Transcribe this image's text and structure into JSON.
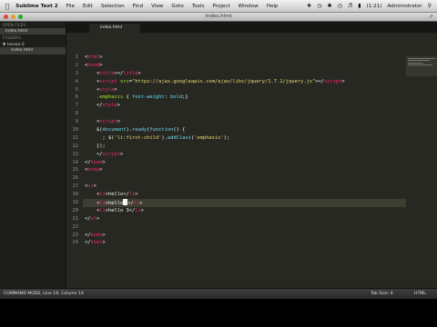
{
  "menubar": {
    "app": "Sublime Text 2",
    "items": [
      "File",
      "Edit",
      "Selection",
      "Find",
      "View",
      "Goto",
      "Tools",
      "Project",
      "Window",
      "Help"
    ],
    "battery": "(1:21)",
    "user": "Administrator"
  },
  "window": {
    "title": "index.html"
  },
  "sidebar": {
    "open_files_header": "OPEN FILES",
    "open_files": [
      "index.html"
    ],
    "folders_header": "FOLDERS",
    "folder": "lesson-2",
    "files": [
      "index.html"
    ]
  },
  "editor": {
    "tab_label": "index.html",
    "current_line": 19,
    "lines": [
      [
        [
          "c-b",
          "<"
        ],
        [
          "c-t",
          "html"
        ],
        [
          "c-b",
          ">"
        ]
      ],
      [
        [
          "c-b",
          "<"
        ],
        [
          "c-t",
          "head"
        ],
        [
          "c-b",
          ">"
        ]
      ],
      [
        [
          "c-b",
          "    <"
        ],
        [
          "c-t",
          "title"
        ],
        [
          "c-b",
          "></"
        ],
        [
          "c-t",
          "title"
        ],
        [
          "c-b",
          ">"
        ]
      ],
      [
        [
          "c-b",
          "    <"
        ],
        [
          "c-t",
          "script"
        ],
        [
          "c-b",
          " "
        ],
        [
          "c-a",
          "src"
        ],
        [
          "c-b",
          "="
        ],
        [
          "c-s",
          "\"https://ajax.googleapis.com/ajax/libs/jquery/1.7.1/jquery.js\""
        ],
        [
          "c-b",
          "></"
        ],
        [
          "c-t",
          "script"
        ],
        [
          "c-b",
          ">"
        ]
      ],
      [
        [
          "c-b",
          "    <"
        ],
        [
          "c-t",
          "style"
        ],
        [
          "c-b",
          ">"
        ]
      ],
      [
        [
          "c-b",
          "    "
        ],
        [
          "c-a",
          ".emphasis"
        ],
        [
          "c-b",
          " { "
        ],
        [
          "c-f",
          "font-weight"
        ],
        [
          "c-b",
          ": "
        ],
        [
          "c-f",
          "bold"
        ],
        [
          "c-b",
          ";}"
        ]
      ],
      [
        [
          "c-b",
          "    </"
        ],
        [
          "c-t",
          "style"
        ],
        [
          "c-b",
          ">"
        ]
      ],
      [],
      [
        [
          "c-b",
          "    <"
        ],
        [
          "c-t",
          "script"
        ],
        [
          "c-b",
          ">"
        ]
      ],
      [
        [
          "c-b",
          "    $("
        ],
        [
          "c-f",
          "document"
        ],
        [
          "c-b",
          ")."
        ],
        [
          "c-f",
          "ready"
        ],
        [
          "c-b",
          "("
        ],
        [
          "c-f",
          "function"
        ],
        [
          "c-b",
          "() {"
        ]
      ],
      [
        [
          "c-b",
          "      ; $("
        ],
        [
          "c-s",
          "'li:first-child'"
        ],
        [
          "c-b",
          ")."
        ],
        [
          "c-f",
          "addClass"
        ],
        [
          "c-b",
          "("
        ],
        [
          "c-s",
          "'emphasis'"
        ],
        [
          "c-b",
          ");"
        ]
      ],
      [
        [
          "c-b",
          "    });"
        ]
      ],
      [
        [
          "c-b",
          "    </"
        ],
        [
          "c-t",
          "script"
        ],
        [
          "c-b",
          ">"
        ]
      ],
      [
        [
          "c-b",
          "</"
        ],
        [
          "c-t",
          "head"
        ],
        [
          "c-b",
          ">"
        ]
      ],
      [
        [
          "c-b",
          "<"
        ],
        [
          "c-t",
          "body"
        ],
        [
          "c-b",
          ">"
        ]
      ],
      [],
      [
        [
          "c-b",
          "<"
        ],
        [
          "c-t",
          "ul"
        ],
        [
          "c-b",
          ">"
        ]
      ],
      [
        [
          "c-b",
          "    <"
        ],
        [
          "c-t",
          "li"
        ],
        [
          "c-b",
          ">hello</"
        ],
        [
          "c-t",
          "li"
        ],
        [
          "c-b",
          ">"
        ]
      ],
      [
        [
          "c-b",
          "    <"
        ],
        [
          "c-t",
          "li"
        ],
        [
          "c-b",
          ">hello"
        ],
        [
          "cursor",
          ""
        ],
        [
          "c-b",
          "</"
        ],
        [
          "c-t",
          "li"
        ],
        [
          "c-b",
          ">"
        ]
      ],
      [
        [
          "c-b",
          "    <"
        ],
        [
          "c-t",
          "li"
        ],
        [
          "c-b",
          ">hello 3</"
        ],
        [
          "c-t",
          "li"
        ],
        [
          "c-b",
          ">"
        ]
      ],
      [
        [
          "c-b",
          "</"
        ],
        [
          "c-t",
          "ul"
        ],
        [
          "c-b",
          ">"
        ]
      ],
      [],
      [
        [
          "c-b",
          "</"
        ],
        [
          "c-t",
          "body"
        ],
        [
          "c-b",
          ">"
        ]
      ],
      [
        [
          "c-b",
          "</"
        ],
        [
          "c-t",
          "html"
        ],
        [
          "c-b",
          ">"
        ]
      ]
    ]
  },
  "statusbar": {
    "mode": "COMMAND MODE, Line 19, Column 14",
    "tab_size": "Tab Size: 4",
    "syntax": "HTML"
  },
  "colors": {
    "editor_bg": "#272822",
    "sidebar_bg": "#1d1e1a",
    "tag": "#f92672",
    "attribute": "#a6e22e",
    "string": "#e6db74",
    "keyword": "#66d9ef"
  }
}
